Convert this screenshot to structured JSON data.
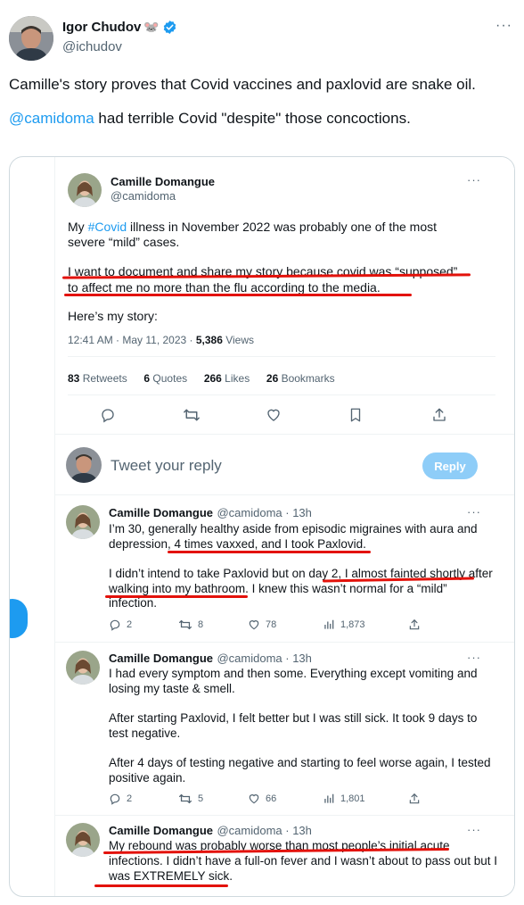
{
  "outer": {
    "author_name": "Igor Chudov",
    "author_emoji": "🐭",
    "author_handle": "@ichudov",
    "more": "···",
    "text_line1": "Camille's story proves that Covid vaccines and paxlovid are snake oil.",
    "mention": "@camidoma",
    "text_line2_rest": " had terrible Covid \"despite\" those concoctions."
  },
  "main_tweet": {
    "name": "Camille Domangue",
    "handle": "@camidoma",
    "more": "···",
    "p1_pre": "My ",
    "p1_tag": "#Covid",
    "p1_post": " illness in November 2022 was probably one of the most",
    "p1_line2": "severe “mild” cases.",
    "p2_line1": "I want to document and share my story because covid was “supposed”",
    "p2_line2": "to affect me no more than the flu according to the media.",
    "p3": "Here’s my story:",
    "time": "12:41 AM · May 11, 2023 · ",
    "views_count": "5,386",
    "views_label": " Views",
    "retweets_count": "83",
    "retweets_label": " Retweets",
    "quotes_count": "6",
    "quotes_label": " Quotes",
    "likes_count": "266",
    "likes_label": " Likes",
    "bookmarks_count": "26",
    "bookmarks_label": " Bookmarks"
  },
  "reply_box": {
    "placeholder": "Tweet your reply",
    "button": "Reply"
  },
  "replies": [
    {
      "name": "Camille Domangue",
      "meta": "@camidoma · 13h",
      "more": "···",
      "lines": [
        "I’m 30, generally healthy aside from episodic migraines with aura and",
        "depression, 4 times vaxxed, and I took Paxlovid.",
        "",
        "I didn’t intend to take Paxlovid but on day 2, I almost fainted shortly after",
        "walking into my bathroom. I knew this wasn’t normal for a “mild”",
        "infection."
      ],
      "replies": "2",
      "retweets": "8",
      "likes": "78",
      "views": "1,873"
    },
    {
      "name": "Camille Domangue",
      "meta": "@camidoma · 13h",
      "more": "···",
      "lines": [
        "I had every symptom and then some. Everything except vomiting and",
        "losing my taste & smell.",
        "",
        "After starting Paxlovid, I felt better but I was still sick. It took 9 days to",
        "test negative.",
        "",
        "After 4 days of testing negative and starting to feel worse again, I tested",
        "positive again."
      ],
      "replies": "2",
      "retweets": "5",
      "likes": "66",
      "views": "1,801"
    },
    {
      "name": "Camille Domangue",
      "meta": "@camidoma · 13h",
      "more": "···",
      "lines": [
        "My rebound was probably worse than most people’s initial acute",
        "infections. I didn’t have a full-on fever and I wasn’t about to pass out but I",
        "was EXTREMELY sick."
      ]
    }
  ],
  "colors": {
    "accent": "#1d9bf0",
    "underline": "#e3120b",
    "muted": "#536471",
    "reply_button": "#8ecdf8"
  }
}
